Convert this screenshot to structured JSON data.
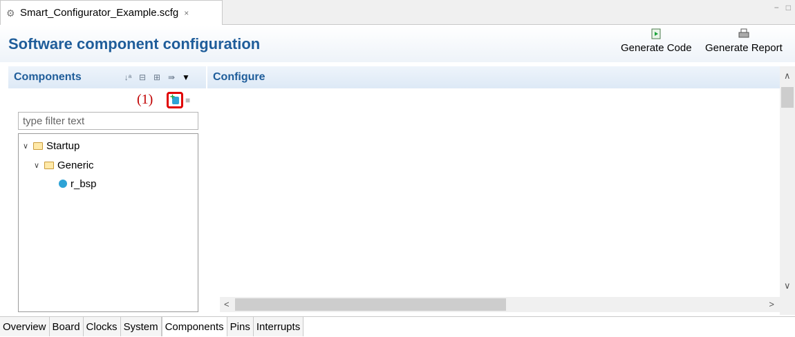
{
  "editor": {
    "tab_title": "Smart_Configurator_Example.scfg",
    "tab_close": "×",
    "window_controls": [
      "−",
      "□"
    ]
  },
  "header": {
    "title": "Software component configuration",
    "generate_code_label": "Generate Code",
    "generate_report_label": "Generate Report"
  },
  "components_panel": {
    "title": "Components",
    "annotation": "(1)",
    "filter_placeholder": "type filter text",
    "tree": [
      {
        "label": "Startup",
        "level": 0,
        "type": "folder"
      },
      {
        "label": "Generic",
        "level": 1,
        "type": "folder"
      },
      {
        "label": "r_bsp",
        "level": 2,
        "type": "component"
      }
    ]
  },
  "configure_panel": {
    "title": "Configure"
  },
  "bottom_tabs": [
    {
      "label": "Overview",
      "active": false
    },
    {
      "label": "Board",
      "active": false
    },
    {
      "label": "Clocks",
      "active": false
    },
    {
      "label": "System",
      "active": false
    },
    {
      "label": "Components",
      "active": true
    },
    {
      "label": "Pins",
      "active": false
    },
    {
      "label": "Interrupts",
      "active": false
    }
  ],
  "icons": [
    "gear-icon",
    "sort-icon",
    "collapse-all-icon",
    "expand-all-icon",
    "link-icon",
    "menu-icon",
    "add-component-icon",
    "remove-component-icon",
    "folder-icon",
    "component-icon",
    "generate-code-icon",
    "generate-report-icon"
  ],
  "colors": {
    "title": "#1f5d9a",
    "annotation": "#c00000",
    "highlight_box": "#e00000"
  }
}
